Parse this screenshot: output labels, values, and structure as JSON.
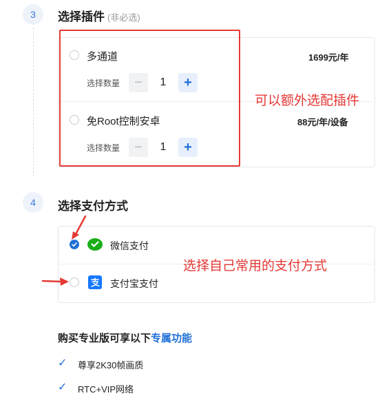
{
  "section3": {
    "number": "3",
    "title": "选择插件",
    "hint": "(非必选)",
    "plugins": [
      {
        "name": "多通道",
        "price": "1699元/年",
        "qty_label": "选择数量",
        "minus": "−",
        "qty": "1",
        "plus": "+"
      },
      {
        "name": "免Root控制安卓",
        "price": "88元/年/设备",
        "qty_label": "选择数量",
        "minus": "−",
        "qty": "1",
        "plus": "+"
      }
    ],
    "annotation": "可以额外选配插件"
  },
  "section4": {
    "number": "4",
    "title": "选择支付方式",
    "options": [
      {
        "label": "微信支付",
        "selected": true,
        "icon": "wechat-pay-icon",
        "color": "#1aad19"
      },
      {
        "label": "支付宝支付",
        "selected": false,
        "icon": "alipay-icon",
        "color": "#1677ff"
      }
    ],
    "annotation": "选择自己常用的支付方式"
  },
  "benefits": {
    "title_prefix": "购买专业版可享以下",
    "title_link": "专属功能",
    "items": [
      "尊享2K30帧画质",
      "RTC+VIP网络"
    ]
  },
  "colors": {
    "accent": "#1f6fd6",
    "annotation_red": "#e53935"
  }
}
